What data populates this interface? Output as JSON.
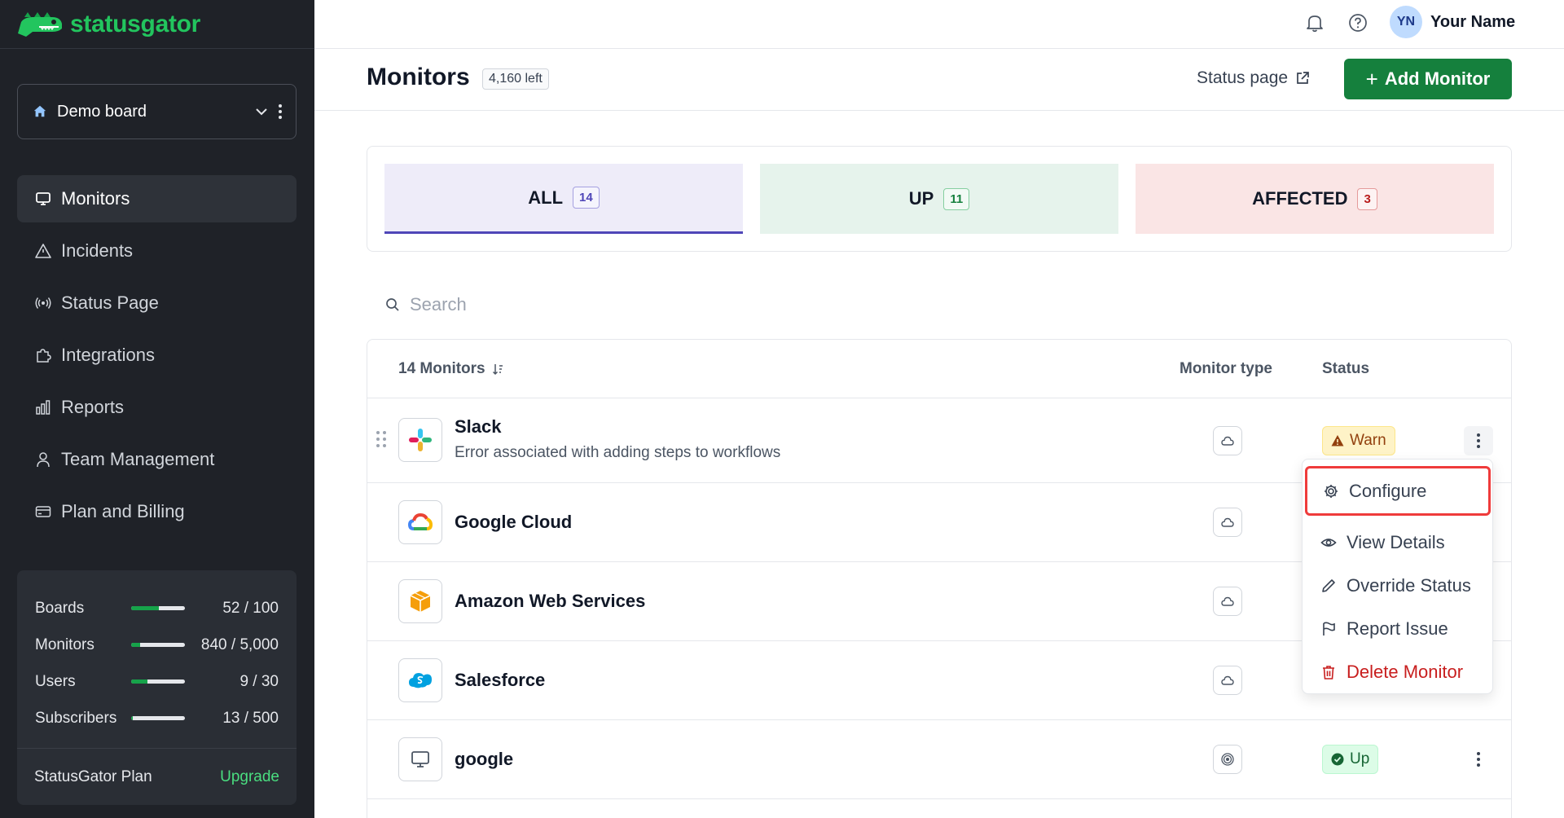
{
  "app": {
    "logo_text": "statusgator"
  },
  "sidebar": {
    "board_name": "Demo board",
    "nav": [
      {
        "label": "Monitors",
        "icon": "monitor-icon",
        "active": true
      },
      {
        "label": "Incidents",
        "icon": "warning-icon"
      },
      {
        "label": "Status Page",
        "icon": "broadcast-icon"
      },
      {
        "label": "Integrations",
        "icon": "puzzle-icon"
      },
      {
        "label": "Reports",
        "icon": "bar-chart-icon"
      },
      {
        "label": "Team Management",
        "icon": "user-icon"
      },
      {
        "label": "Plan and Billing",
        "icon": "credit-card-icon"
      }
    ],
    "usage": [
      {
        "label": "Boards",
        "value": "52 / 100",
        "fraction": 0.52
      },
      {
        "label": "Monitors",
        "value": "840 / 5,000",
        "fraction": 0.168
      },
      {
        "label": "Users",
        "value": "9 / 30",
        "fraction": 0.3
      },
      {
        "label": "Subscribers",
        "value": "13 / 500",
        "fraction": 0.026
      }
    ],
    "plan_label": "StatusGator Plan",
    "upgrade_label": "Upgrade"
  },
  "topbar": {
    "avatar_initials": "YN",
    "user_name": "Your Name"
  },
  "header": {
    "title": "Monitors",
    "left_badge": "4,160 left",
    "status_page_label": "Status page",
    "add_button_label": "Add Monitor"
  },
  "filters": [
    {
      "label": "ALL",
      "count": "14"
    },
    {
      "label": "UP",
      "count": "11"
    },
    {
      "label": "AFFECTED",
      "count": "3"
    }
  ],
  "search": {
    "placeholder": "Search"
  },
  "table": {
    "count_header": "14 Monitors",
    "type_header": "Monitor type",
    "status_header": "Status",
    "rows": [
      {
        "name": "Slack",
        "description": "Error associated with adding steps to workflows",
        "type_icon": "cloud-icon",
        "status": "Warn"
      },
      {
        "name": "Google Cloud",
        "type_icon": "cloud-icon"
      },
      {
        "name": "Amazon Web Services",
        "type_icon": "cloud-icon"
      },
      {
        "name": "Salesforce",
        "type_icon": "cloud-icon"
      },
      {
        "name": "google",
        "type_icon": "ping-icon",
        "status": "Up"
      }
    ]
  },
  "dropdown": [
    {
      "label": "Configure",
      "icon": "gear-icon"
    },
    {
      "label": "View Details",
      "icon": "eye-icon"
    },
    {
      "label": "Override Status",
      "icon": "pencil-icon"
    },
    {
      "label": "Report Issue",
      "icon": "flag-icon"
    },
    {
      "label": "Delete Monitor",
      "icon": "trash-icon"
    }
  ],
  "colors": {
    "sidebar_bg": "#1f2228",
    "brand_green": "#22c55e",
    "primary_button": "#15803d",
    "accent_purple": "#4f46b8",
    "highlight_red": "#ef3b3b"
  }
}
